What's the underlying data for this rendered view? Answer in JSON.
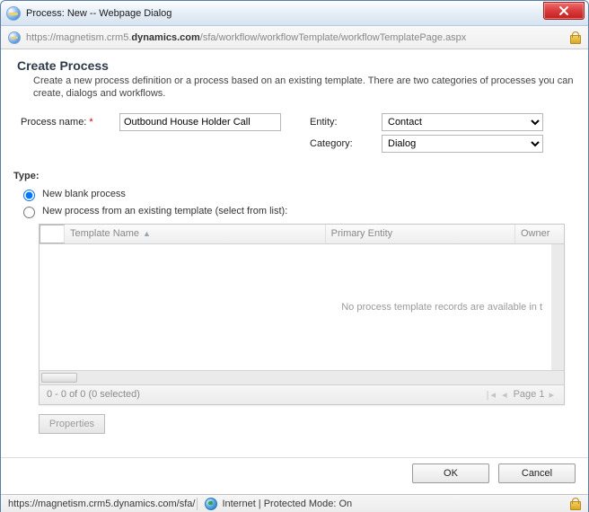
{
  "window": {
    "title": "Process: New -- Webpage Dialog"
  },
  "url": {
    "prefix": "https://magnetism.crm5.",
    "bold": "dynamics.com",
    "suffix": "/sfa/workflow/workflowTemplate/workflowTemplatePage.aspx"
  },
  "page": {
    "heading": "Create Process",
    "description": "Create a new process definition or a process based on an existing template. There are two categories of processes you can create, dialogs and workflows."
  },
  "form": {
    "process_name_label": "Process name:",
    "process_name_value": "Outbound House Holder Call",
    "entity_label": "Entity:",
    "entity_value": "Contact",
    "category_label": "Category:",
    "category_value": "Dialog"
  },
  "type": {
    "label": "Type:",
    "opt_blank": "New blank process",
    "opt_template": "New process from an existing template (select from list):"
  },
  "grid": {
    "col_template": "Template Name",
    "col_entity": "Primary Entity",
    "col_owner": "Owner",
    "empty_text": "No process template records are available in t",
    "footer_count": "0 - 0 of 0 (0 selected)",
    "page_label": "Page 1"
  },
  "buttons": {
    "properties": "Properties",
    "ok": "OK",
    "cancel": "Cancel"
  },
  "status": {
    "url": "https://magnetism.crm5.dynamics.com/sfa/",
    "zone": "Internet | Protected Mode: On"
  }
}
